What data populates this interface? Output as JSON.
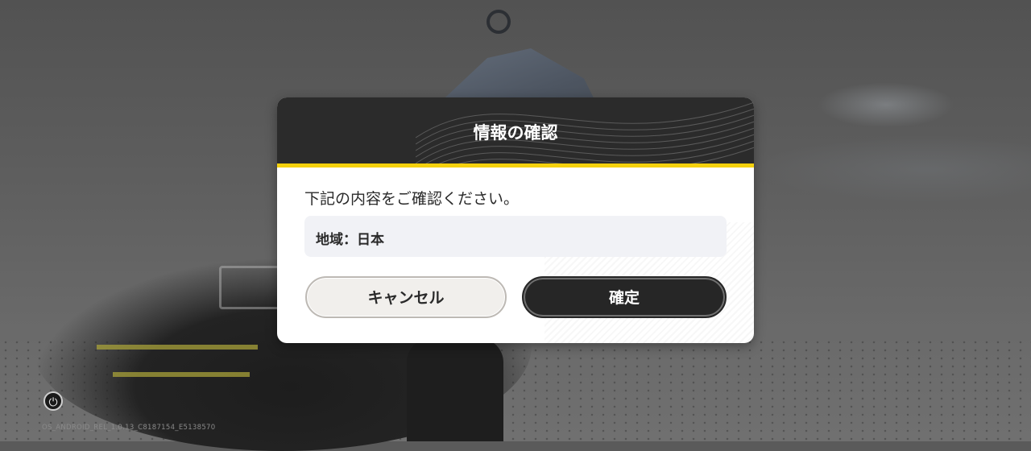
{
  "dialog": {
    "title": "情報の確認",
    "message": "下記の内容をご確認ください。",
    "info": "地域：日本",
    "cancel_label": "キャンセル",
    "confirm_label": "確定"
  },
  "footer": {
    "power_icon": "power-icon",
    "build_label": "OS_ANDROID_REL_1.0.13_C8187154_E5138570"
  },
  "colors": {
    "accent": "#f5d10d",
    "header": "#2b2b2b",
    "confirm_button": "#262626",
    "cancel_button": "#f1efec",
    "info_box": "#f1f2f6"
  }
}
